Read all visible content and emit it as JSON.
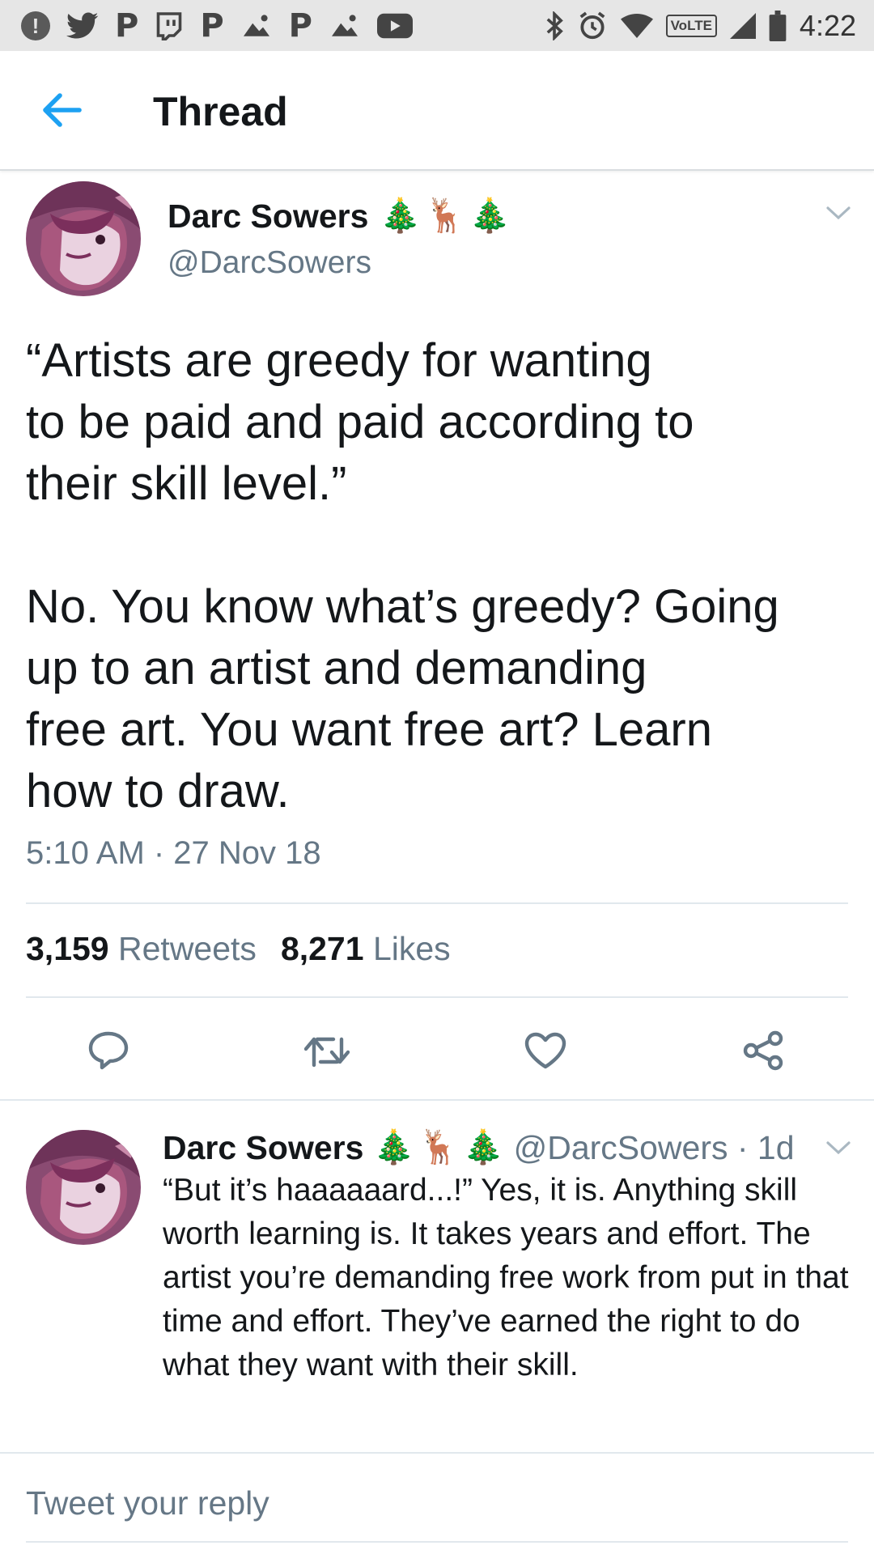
{
  "status_bar": {
    "alert_glyph": "!",
    "app_letter": "P",
    "network_label": "VoLTE",
    "time": "4:22",
    "icons": [
      "alert-icon",
      "twitter-bird-icon",
      "pinterest-icon",
      "twitch-icon",
      "pinterest-icon",
      "pinterest-icon",
      "picture-icon",
      "youtube-icon",
      "bluetooth-icon",
      "alarm-icon",
      "wifi-icon",
      "signal-icon",
      "battery-icon"
    ]
  },
  "header": {
    "title": "Thread",
    "back_icon": "arrow-left-icon"
  },
  "main_tweet": {
    "display_name": "Darc Sowers",
    "name_emojis": [
      "🎄",
      "🦌",
      "🎄"
    ],
    "handle": "@DarcSowers",
    "text": "“Artists are greedy for wanting\nto be paid and paid according to\ntheir skill level.”\n\nNo. You know what’s greedy? Going\nup to an artist and demanding\nfree art. You want free art? Learn\nhow to draw.",
    "timestamp": "5:10 AM · 27 Nov 18",
    "retweet_count": "3,159",
    "retweet_label": "Retweets",
    "like_count": "8,271",
    "like_label": "Likes"
  },
  "actions": {
    "icons": [
      "reply-icon",
      "retweet-icon",
      "like-icon",
      "share-icon"
    ]
  },
  "reply_tweet": {
    "display_name": "Darc Sowers",
    "name_emojis": [
      "🎄",
      "🦌",
      "🎄"
    ],
    "handle_time": "@DarcSowers · 1d",
    "text": "“But it’s haaaaaard...!” Yes, it is. Anything skill worth learning is. It takes years and effort. The artist you’re demanding free work from put in that time and effort. They’ve earned the right to do what they want with their skill."
  },
  "reply_box": {
    "placeholder": "Tweet your reply"
  },
  "colors": {
    "accent_blue": "#1da1f2",
    "text_primary": "#14171a",
    "text_secondary": "#657786",
    "divider": "#e1e8ed",
    "status_bar_bg": "#e6e6e6"
  }
}
